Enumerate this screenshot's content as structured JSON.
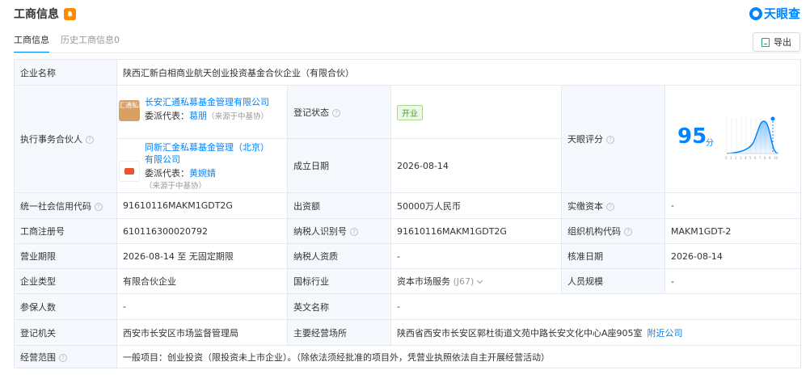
{
  "header": {
    "title": "工商信息",
    "logo_text": "天眼查"
  },
  "tabs": [
    {
      "label": "工商信息",
      "active": true
    },
    {
      "label": "历史工商信息0",
      "active": false
    }
  ],
  "toolbar": {
    "export_label": "导出"
  },
  "rows": {
    "company_name": {
      "label": "企业名称",
      "value": "陕西汇新白相商业航天创业投资基金合伙企业（有限合伙）"
    },
    "partner": {
      "label": "执行事务合伙人",
      "items": [
        {
          "logo_text": "汇通私募",
          "name": "长安汇通私募基金管理有限公司",
          "rep_label": "委派代表：",
          "rep_name": "葛朋",
          "source": "（来源于中基协）"
        },
        {
          "name": "同新汇金私募基金管理（北京）有限公司",
          "rep_label": "委派代表：",
          "rep_name": "黄婉婧",
          "source": "（来源于中基协）"
        }
      ]
    },
    "reg_status": {
      "label": "登记状态",
      "value": "开业"
    },
    "established": {
      "label": "成立日期",
      "value": "2026-08-14"
    },
    "rating": {
      "label": "天眼评分",
      "score": "95",
      "unit": "分",
      "axis": [
        "0",
        "1",
        "2",
        "3",
        "4",
        "5",
        "6",
        "7",
        "8",
        "9",
        "10"
      ]
    },
    "credit_code": {
      "label": "统一社会信用代码",
      "value": "91610116MAKM1GDT2G"
    },
    "capital": {
      "label": "出资额",
      "value": "50000万人民币"
    },
    "paid_capital": {
      "label": "实缴资本",
      "value": "-"
    },
    "reg_no": {
      "label": "工商注册号",
      "value": "610116300020792"
    },
    "taxpayer_id": {
      "label": "纳税人识别号",
      "value": "91610116MAKM1GDT2G"
    },
    "org_code": {
      "label": "组织机构代码",
      "value": "MAKM1GDT-2"
    },
    "term": {
      "label": "营业期限",
      "value": "2026-08-14 至 无固定期限"
    },
    "taxpayer_qual": {
      "label": "纳税人资质",
      "value": "-"
    },
    "approved_date": {
      "label": "核准日期",
      "value": "2026-08-14"
    },
    "company_type": {
      "label": "企业类型",
      "value": "有限合伙企业"
    },
    "industry": {
      "label": "国标行业",
      "value": "资本市场服务",
      "code": "(J67)"
    },
    "staff_size": {
      "label": "人员规模",
      "value": "-"
    },
    "insured": {
      "label": "参保人数",
      "value": "-"
    },
    "english_name": {
      "label": "英文名称",
      "value": "-"
    },
    "authority": {
      "label": "登记机关",
      "value": "西安市长安区市场监督管理局"
    },
    "address": {
      "label": "主要经营场所",
      "value": "陕西省西安市长安区郭杜街道文苑中路长安文化中心A座905室",
      "link": "附近公司"
    },
    "scope": {
      "label": "经营范围",
      "value": "一般项目：创业投资（限投资未上市企业）。（除依法须经批准的项目外，凭营业执照依法自主开展经营活动）"
    }
  },
  "colors": {
    "accent": "#0084ff",
    "status_green": "#4a9b2a",
    "label_bg": "#f5f8fc",
    "bell": "#ff8a00"
  }
}
